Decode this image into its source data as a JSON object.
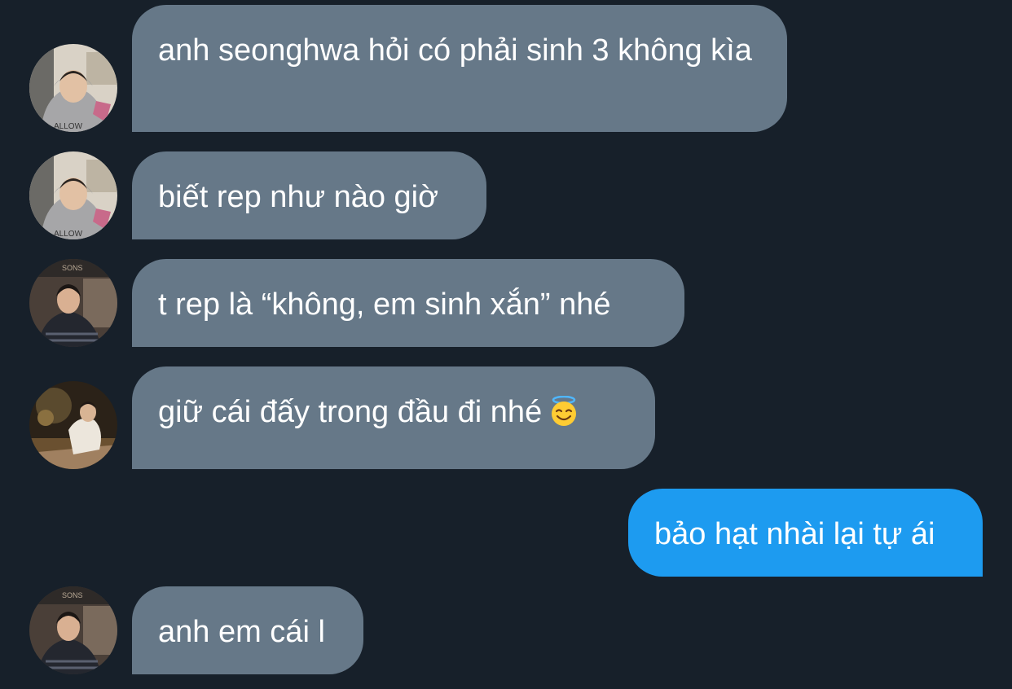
{
  "conversation": {
    "messages": [
      {
        "direction": "incoming",
        "text": "anh seonghwa hỏi có phải sinh 3 không kìa",
        "avatar": "avatar-hoodie"
      },
      {
        "direction": "incoming",
        "text": "biết rep như nào giờ",
        "avatar": "avatar-hoodie"
      },
      {
        "direction": "incoming",
        "text": "t rep là “không, em sinh xắn” nhé",
        "avatar": "avatar-dark-shirt"
      },
      {
        "direction": "incoming",
        "text": "giữ cái đấy trong đầu đi nhé",
        "emoji": "smiling-face-with-halo-icon",
        "avatar": "avatar-night-scene"
      },
      {
        "direction": "outgoing",
        "text": "bảo hạt nhài lại tự ái"
      },
      {
        "direction": "incoming",
        "text": "anh em cái l",
        "avatar": "avatar-dark-shirt"
      }
    ]
  },
  "colors": {
    "background": "#17202a",
    "incoming_bubble": "#667888",
    "outgoing_bubble": "#1d9bf0",
    "text": "#ffffff"
  }
}
